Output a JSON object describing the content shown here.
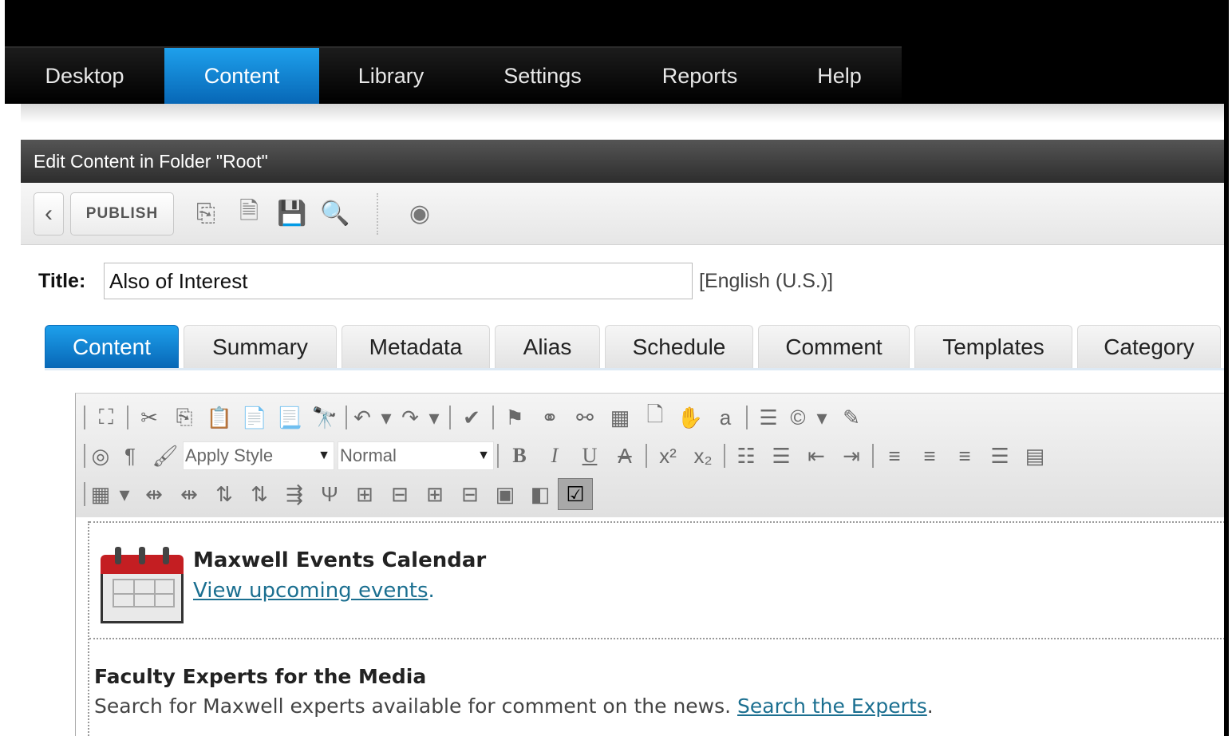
{
  "nav": {
    "items": [
      {
        "label": "Desktop"
      },
      {
        "label": "Content"
      },
      {
        "label": "Library"
      },
      {
        "label": "Settings"
      },
      {
        "label": "Reports"
      },
      {
        "label": "Help"
      }
    ],
    "active": "Content"
  },
  "panel": {
    "title": "Edit Content in Folder \"Root\""
  },
  "toolbar": {
    "back_label": "‹",
    "publish_label": "PUBLISH"
  },
  "form": {
    "title_label": "Title:",
    "title_value": "Also of Interest",
    "language": "[English (U.S.)]"
  },
  "tabs": [
    {
      "label": "Content"
    },
    {
      "label": "Summary"
    },
    {
      "label": "Metadata"
    },
    {
      "label": "Alias"
    },
    {
      "label": "Schedule"
    },
    {
      "label": "Comment"
    },
    {
      "label": "Templates"
    },
    {
      "label": "Category"
    }
  ],
  "editor": {
    "style_select": "Apply Style",
    "format_select": "Normal"
  },
  "content": {
    "block1_heading": "Maxwell Events Calendar",
    "block1_link": "View upcoming events",
    "block1_suffix": ".",
    "block2_heading": "Faculty Experts for the Media",
    "block2_text": "Search for Maxwell experts available for comment on the news. ",
    "block2_link": "Search the Experts",
    "block2_suffix": "."
  },
  "colors": {
    "accent": "#0b7fd0",
    "link": "#1b6f90",
    "calendar_red": "#c41e22"
  }
}
